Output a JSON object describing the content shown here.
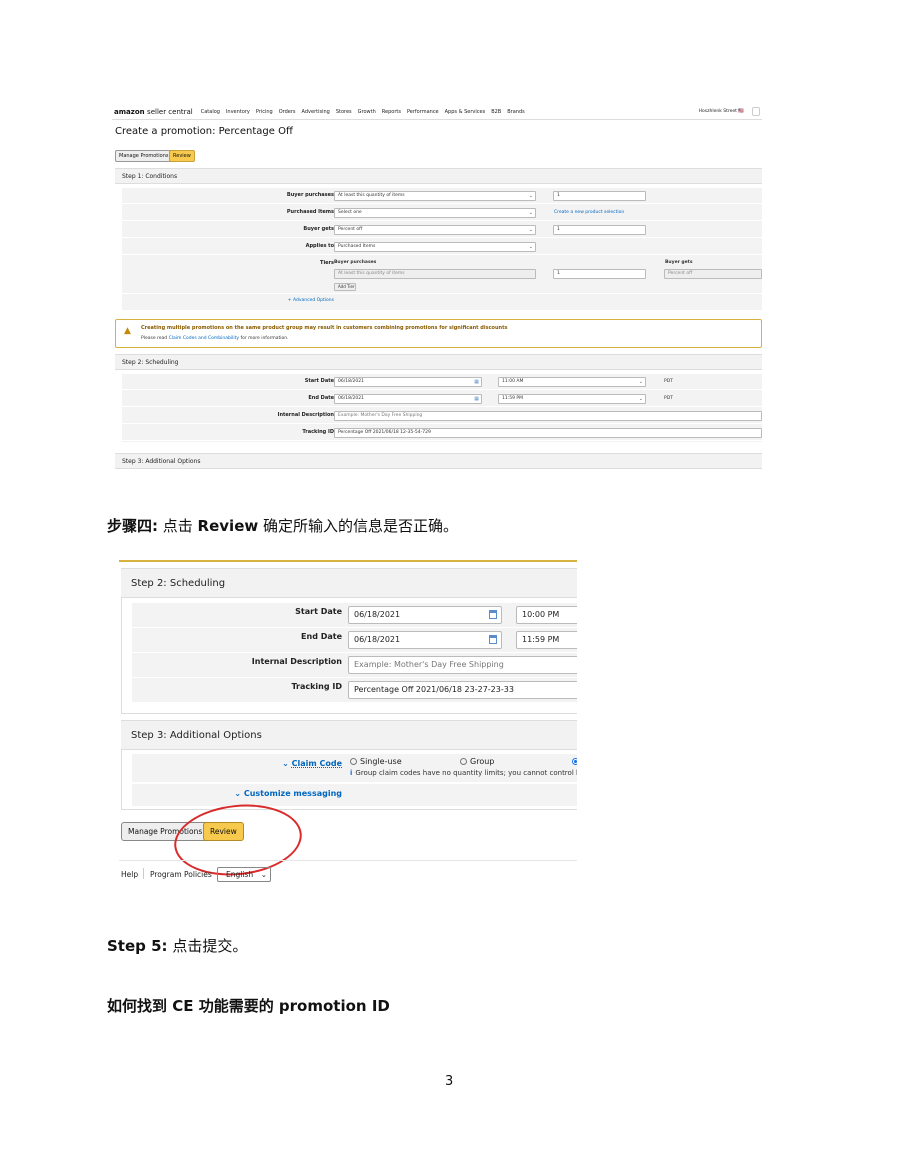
{
  "shot1": {
    "logo_brand": "amazon",
    "logo_suffix": "seller central",
    "nav": [
      "Catalog",
      "Inventory",
      "Pricing",
      "Orders",
      "Advertising",
      "Stores",
      "Growth",
      "Reports",
      "Performance",
      "Apps & Services",
      "B2B",
      "Brands"
    ],
    "account": "Hoszhlenk Street",
    "flag": "🇺🇸",
    "page_title": "Create a promotion: Percentage Off",
    "manage_btn": "Manage Promotions",
    "review_btn": "Review",
    "step1": "Step 1: Conditions",
    "buyer_purchases_label": "Buyer purchases",
    "buyer_purchases_value": "At least this quantity of items",
    "buyer_purchases_qty": "1",
    "purchased_items_label": "Purchased Items",
    "purchased_items_value": "Select one",
    "create_selection_link": "Create a new product selection",
    "buyer_gets_label": "Buyer gets",
    "buyer_gets_value": "Percent off",
    "buyer_gets_qty": "1",
    "applies_to_label": "Applies to",
    "applies_to_value": "Purchased Items",
    "tiers_label": "Tiers",
    "tiers_col1": "Buyer purchases",
    "tiers_col2": "Buyer gets",
    "tiers_field1": "At least this quantity of items",
    "tiers_field2": "1",
    "tiers_field3": "Percent off",
    "add_tier_btn": "Add Tier",
    "advanced_options": "+ Advanced Options",
    "warning_title": "Creating multiple promotions on the same product group may result in customers combining promotions for significant discounts",
    "warning_prefix": "Please read",
    "warning_link": "Claim Codes and Combinability",
    "warning_suffix": "for more information.",
    "step2": "Step 2: Scheduling",
    "start_date_label": "Start Date",
    "start_date_value": "06/18/2021",
    "start_time_value": "11:00 AM",
    "tz1": "PDT",
    "end_date_label": "End Date",
    "end_date_value": "06/18/2021",
    "end_time_value": "11:59 PM",
    "tz2": "PDT",
    "internal_desc_label": "Internal Description",
    "internal_desc_placeholder": "Example: Mother's Day Free Shipping",
    "tracking_id_label": "Tracking ID",
    "tracking_id_value": "Percentage Off 2021/06/18 12-35-54-729",
    "step3": "Step 3: Additional Options"
  },
  "para1": {
    "bold": "步骤四:",
    "text_a": " 点击 ",
    "bold2": "Review",
    "text_b": " 确定所输入的信息是否正确。"
  },
  "shot2": {
    "step2": "Step 2: Scheduling",
    "start_date_label": "Start Date",
    "start_date_value": "06/18/2021",
    "start_time_value": "10:00 PM",
    "end_date_label": "End Date",
    "end_date_value": "06/18/2021",
    "end_time_value": "11:59 PM",
    "internal_desc_label": "Internal Description",
    "internal_desc_placeholder": "Example: Mother's Day Free Shipping",
    "tracking_id_label": "Tracking ID",
    "tracking_id_value": "Percentage Off 2021/06/18 23-27-23-33",
    "step3": "Step 3: Additional Options",
    "claim_code_label": "Claim Code",
    "radio_single": "Single-use",
    "radio_group": "Group",
    "claim_info": "Group claim codes have no quantity limits; you cannot control how many",
    "customize_messaging": "Customize messaging",
    "manage_btn": "Manage Promotions",
    "review_btn": "Review",
    "footer_help": "Help",
    "footer_policies": "Program Policies",
    "footer_lang": "English"
  },
  "para2": {
    "bold": "Step 5:",
    "text": " 点击提交。"
  },
  "para3": {
    "bold": "如何找到 CE 功能需要的 promotion ID"
  },
  "page_number": "3"
}
